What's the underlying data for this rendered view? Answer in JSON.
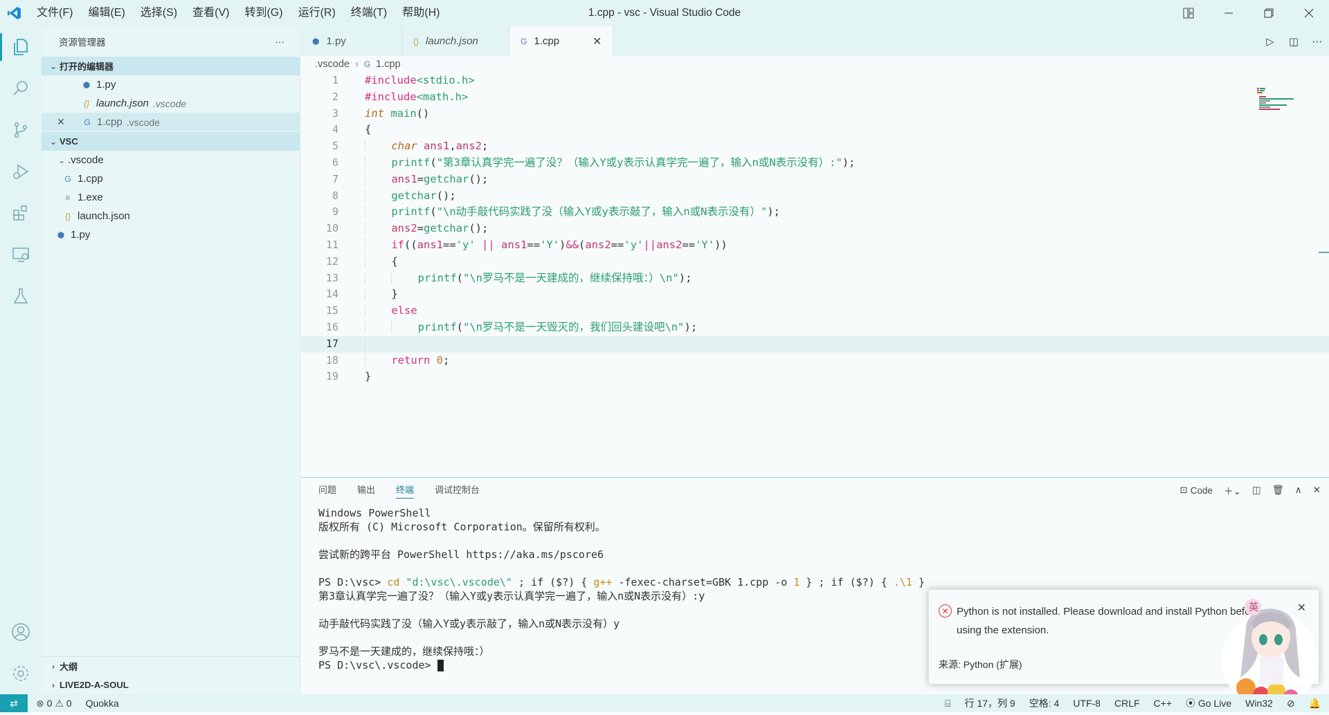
{
  "window": {
    "title": "1.cpp - vsc - Visual Studio Code"
  },
  "menu": [
    "文件(F)",
    "编辑(E)",
    "选择(S)",
    "查看(V)",
    "转到(G)",
    "运行(R)",
    "终端(T)",
    "帮助(H)"
  ],
  "sidebar": {
    "title": "资源管理器",
    "more": "···",
    "open_editors_label": "打开的编辑器",
    "open_editors": [
      {
        "name": "1.py",
        "desc": "",
        "icon": "python-icon"
      },
      {
        "name": "launch.json",
        "desc": ".vscode",
        "icon": "json-icon"
      },
      {
        "name": "1.cpp",
        "desc": ".vscode",
        "icon": "cpp-icon"
      }
    ],
    "folder_label": "VSC",
    "tree": [
      {
        "name": ".vscode",
        "type": "folder"
      },
      {
        "name": "1.cpp",
        "type": "cpp"
      },
      {
        "name": "1.exe",
        "type": "exe"
      },
      {
        "name": "launch.json",
        "type": "json"
      },
      {
        "name": "1.py",
        "type": "python"
      }
    ],
    "outline_label": "大纲",
    "live2d_label": "LIVE2D-A-SOUL"
  },
  "tabs": [
    {
      "label": "1.py",
      "icon": "python-icon"
    },
    {
      "label": "launch.json",
      "icon": "json-icon"
    },
    {
      "label": "1.cpp",
      "icon": "cpp-icon"
    }
  ],
  "breadcrumb": {
    "folder": ".vscode",
    "file": "1.cpp"
  },
  "code": {
    "line_numbers": [
      "1",
      "2",
      "3",
      "4",
      "5",
      "6",
      "7",
      "8",
      "9",
      "10",
      "11",
      "12",
      "13",
      "14",
      "15",
      "16",
      "17",
      "18",
      "19"
    ],
    "current_line": "17"
  },
  "panel": {
    "tabs": [
      "问题",
      "输出",
      "终端",
      "调试控制台"
    ],
    "active_tab": "终端",
    "terminal_name": "Code",
    "terminal_lines": [
      "Windows PowerShell",
      "版权所有 (C) Microsoft Corporation。保留所有权利。",
      "",
      "尝试新的跨平台 PowerShell https://aka.ms/pscore6",
      "",
      "",
      "第3章认真学完一遍了没？（输入Y或y表示认真学完一遍了，输入n或N表示没有）:y",
      "",
      "动手敲代码实践了没（输入Y或y表示敲了，输入n或N表示没有）y",
      "",
      "罗马不是一天建成的，继续保持哦：）",
      "PS D:\\vsc\\.vscode> "
    ],
    "cmd_prompt": "PS D:\\vsc> ",
    "cmd_parts": [
      "cd",
      " \"d:\\vsc\\.vscode\\\"",
      " ; if ($?) { ",
      "g++",
      " -fexec-charset=GBK 1.cpp -o ",
      "1",
      " } ; if ($?) { ",
      ".\\1",
      " }"
    ]
  },
  "notification": {
    "message": "Python is not installed. Please download and install Python before using the extension.",
    "source": "来源: Python (扩展)"
  },
  "status": {
    "errors": "0",
    "warnings": "0",
    "quokka": "Quokka",
    "position": "行 17，列 9",
    "spaces": "空格: 4",
    "encoding": "UTF-8",
    "eol": "CRLF",
    "language": "C++",
    "golive": "Go Live",
    "platform": "Win32"
  },
  "colors": {
    "accent": "#1aa0b0",
    "error": "#e0343a",
    "keyword": "#d5307e",
    "string": "#2a9d6c"
  }
}
